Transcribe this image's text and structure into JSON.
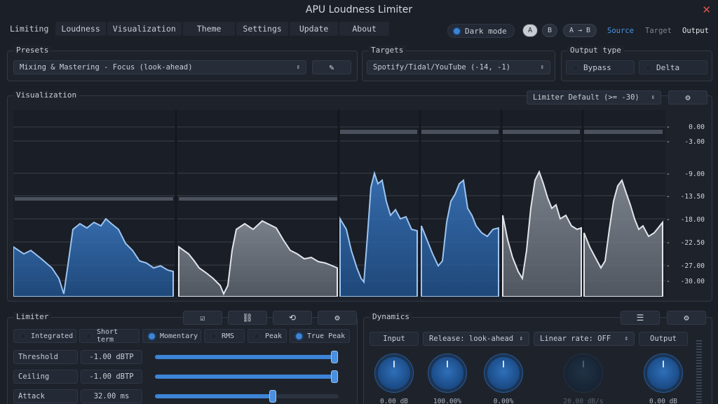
{
  "window": {
    "title": "APU Loudness Limiter"
  },
  "tabs": [
    "Limiting",
    "Loudness",
    "Visualization",
    "Theme",
    "Settings",
    "Update",
    "About"
  ],
  "header": {
    "dark_mode_label": "Dark mode",
    "ab_buttons": [
      "A",
      "B",
      "A → B"
    ],
    "monitor": [
      "Source",
      "Target",
      "Output"
    ]
  },
  "presets": {
    "label": "Presets",
    "value": "Mixing & Mastering - Focus (look-ahead)"
  },
  "targets": {
    "label": "Targets",
    "value": "Spotify/Tidal/YouTube (-14, -1)"
  },
  "output_type": {
    "label": "Output type",
    "options": [
      "Bypass",
      "Delta"
    ]
  },
  "visualization": {
    "label": "Visualization",
    "mode": "Limiter Default (>= -30)",
    "scale": [
      "0.00",
      "-3.00",
      "-9.00",
      "-13.50",
      "-18.00",
      "-22.50",
      "-27.00",
      "-30.00"
    ]
  },
  "limiter": {
    "label": "Limiter",
    "modes": [
      "Integrated",
      "Short term",
      "Momentary",
      "RMS",
      "Peak",
      "True Peak"
    ],
    "modes_on": [
      false,
      false,
      true,
      false,
      false,
      true
    ],
    "params": [
      {
        "name": "Threshold",
        "value": "-1.00 dBTP",
        "level": 0.99
      },
      {
        "name": "Ceiling",
        "value": "-1.00 dBTP",
        "level": 0.99
      },
      {
        "name": "Attack",
        "value": "32.00 ms",
        "level": 0.65
      }
    ]
  },
  "dynamics": {
    "label": "Dynamics",
    "input_label": "Input",
    "release": "Release: look-ahead",
    "linear_rate": "Linear rate: OFF",
    "output_label": "Output",
    "knobs": [
      "0.00 dB",
      "100.00%",
      "0.00%",
      "20.00 dB/s",
      "0.00 dB"
    ]
  },
  "colors": {
    "accent": "#3d84d6",
    "background": "#1b1f27",
    "close": "#d9534f"
  }
}
